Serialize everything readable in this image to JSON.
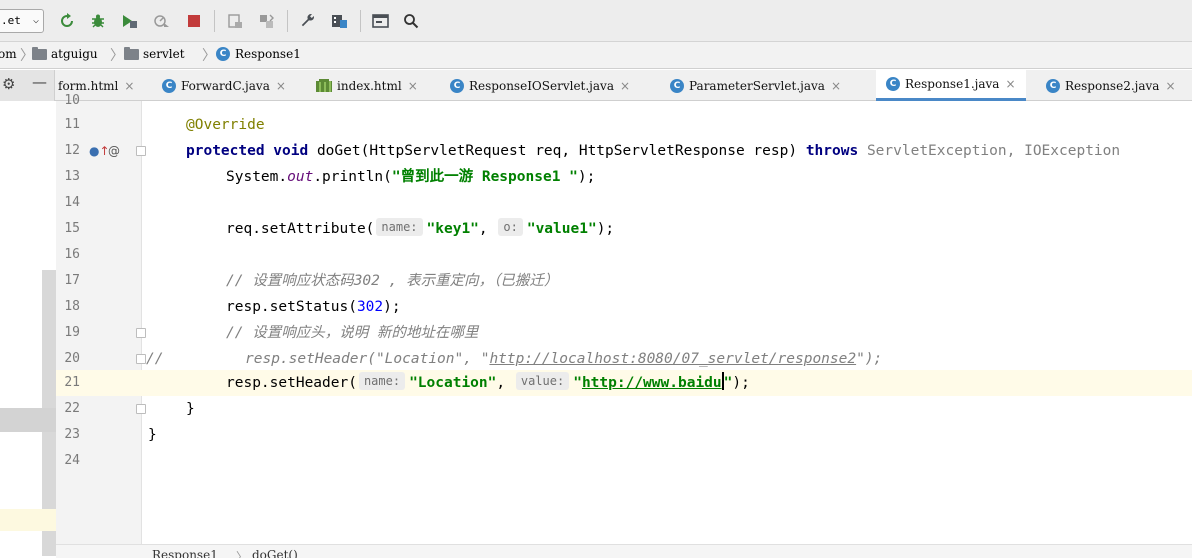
{
  "toolbar": {
    "run_config": ".et",
    "icons": [
      "rerun-icon",
      "debug-icon",
      "run-coverage-icon",
      "profile-icon",
      "stop-icon",
      "build-icon",
      "build-artifact-icon",
      "wrench-icon",
      "project-structure-icon",
      "terminal-icon",
      "search-icon"
    ],
    "colors": {
      "run": "#3b8b3b",
      "stop": "#c23b3b"
    }
  },
  "breadcrumb": {
    "items": [
      "om",
      "atguigu",
      "servlet",
      "Response1"
    ],
    "class_badge": "C"
  },
  "tabs": [
    {
      "label": "form.html",
      "close": "×",
      "icon": "html"
    },
    {
      "label": "ForwardC.java",
      "close": "×",
      "icon": "C"
    },
    {
      "label": "index.html",
      "close": "×",
      "icon": "html"
    },
    {
      "label": "ResponseIOServlet.java",
      "close": "×",
      "icon": "C"
    },
    {
      "label": "ParameterServlet.java",
      "close": "×",
      "icon": "C"
    },
    {
      "label": "Response1.java",
      "close": "×",
      "icon": "C",
      "active": true
    },
    {
      "label": "Response2.java",
      "close": "×",
      "icon": "C"
    }
  ],
  "editor": {
    "lines": [
      {
        "n": "10"
      },
      {
        "n": "11",
        "a": "@Override"
      },
      {
        "n": "12",
        "k1": "protected void",
        "t1": " doGet(HttpServletRequest req, HttpServletResponse resp) ",
        "k2": "throws",
        "g1": " ServletException, IOException"
      },
      {
        "n": "13",
        "t1": "System.",
        "f1": "out",
        "t2": ".println(",
        "s1": "\"曾到此一游 Response1 \"",
        "t3": ");"
      },
      {
        "n": "14"
      },
      {
        "n": "15",
        "t1": "req.setAttribute(",
        "h1": "name:",
        "s1": "\"key1\"",
        "t2": ", ",
        "h2": "o:",
        "s2": "\"value1\"",
        "t3": ");"
      },
      {
        "n": "16"
      },
      {
        "n": "17",
        "c1": "// 设置响应状态码302 , 表示重定向，（已搬迁）"
      },
      {
        "n": "18",
        "t1": "resp.setStatus(",
        "num": "302",
        "t2": ");"
      },
      {
        "n": "19",
        "c1": "// 设置响应头，说明 新的地址在哪里"
      },
      {
        "n": "20",
        "c0": "//",
        "c1": "resp.setHeader(\"Location\", \"",
        "u1": "http://localhost:8080/07_servlet/response2",
        "c2": "\");"
      },
      {
        "n": "21",
        "t1": "resp.setHeader(",
        "h1": "name:",
        "s1": "\"Location\"",
        "t2": ", ",
        "h2": "value:",
        "s2": "\"",
        "u1": "http://www.baidu",
        "s3": "\"",
        "t3": ");"
      },
      {
        "n": "22",
        "t1": "}"
      },
      {
        "n": "23",
        "t1": "}"
      },
      {
        "n": "24"
      }
    ],
    "current_line": "21"
  },
  "footer": {
    "crumbs": [
      "Response1",
      "doGet()"
    ],
    "sep": "〉"
  }
}
